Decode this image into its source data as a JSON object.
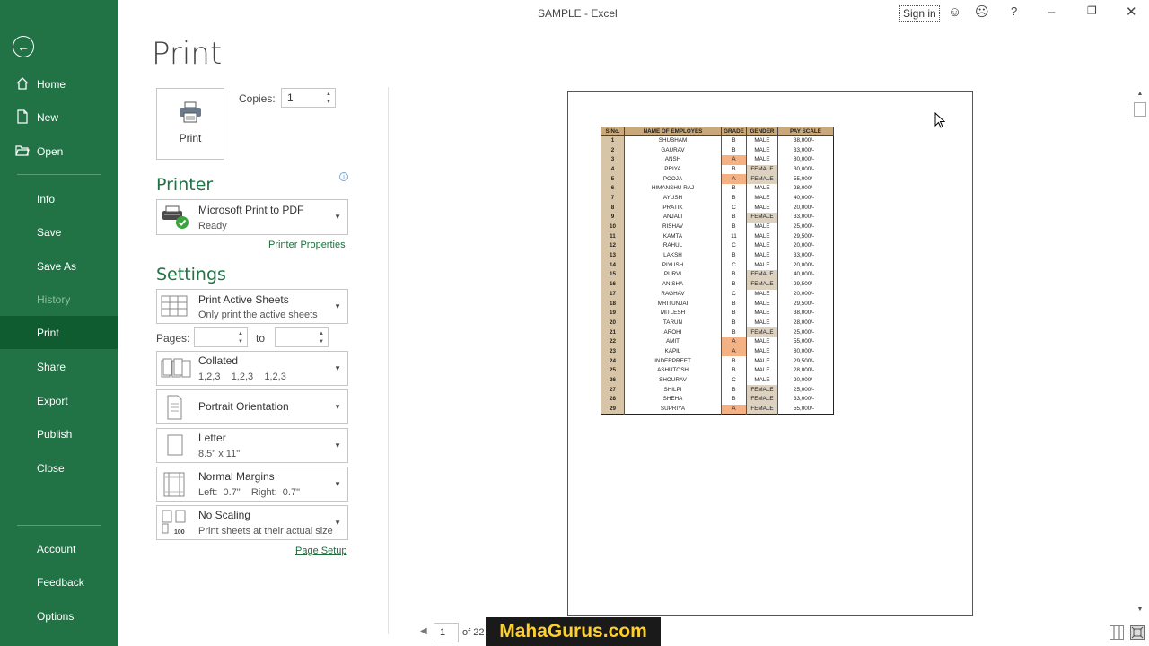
{
  "window": {
    "title": "SAMPLE  -  Excel",
    "sign_in": "Sign in",
    "help": "?",
    "smile_icon": "smile-icon",
    "frown_icon": "frown-icon"
  },
  "sidebar": {
    "items": [
      {
        "label": "Home"
      },
      {
        "label": "New"
      },
      {
        "label": "Open"
      },
      {
        "label": "Info"
      },
      {
        "label": "Save"
      },
      {
        "label": "Save As"
      },
      {
        "label": "History"
      },
      {
        "label": "Print"
      },
      {
        "label": "Share"
      },
      {
        "label": "Export"
      },
      {
        "label": "Publish"
      },
      {
        "label": "Close"
      },
      {
        "label": "Account"
      },
      {
        "label": "Feedback"
      },
      {
        "label": "Options"
      }
    ],
    "accent": "#217346",
    "active_bg": "#0e5c2f"
  },
  "print": {
    "title": "Print",
    "button_label": "Print",
    "copies_label": "Copies:",
    "copies_value": "1"
  },
  "printer": {
    "heading": "Printer",
    "name": "Microsoft Print to PDF",
    "status": "Ready",
    "properties_link": "Printer Properties"
  },
  "settings": {
    "heading": "Settings",
    "sheets": {
      "title": "Print Active Sheets",
      "desc": "Only print the active sheets"
    },
    "pages_label": "Pages:",
    "to_label": "to",
    "collate": {
      "title": "Collated",
      "desc": "1,2,3    1,2,3    1,2,3"
    },
    "orientation": {
      "title": "Portrait Orientation"
    },
    "paper": {
      "title": "Letter",
      "desc": "8.5\" x 11\""
    },
    "margins": {
      "title": "Normal Margins",
      "desc": "Left:  0.7\"    Right:  0.7\""
    },
    "scaling": {
      "title": "No Scaling",
      "desc": "Print sheets at their actual size",
      "icon_text": "100"
    },
    "page_setup_link": "Page Setup"
  },
  "preview": {
    "headers": [
      "S.No.",
      "NAME OF EMPLOYES",
      "GRADE",
      "GENDER",
      "PAY SCALE"
    ],
    "rows": [
      [
        "1",
        "SHUBHAM",
        "B",
        "MALE",
        "38,000/-"
      ],
      [
        "2",
        "GAURAV",
        "B",
        "MALE",
        "33,000/-"
      ],
      [
        "3",
        "ANSH",
        "A",
        "MALE",
        "80,000/-"
      ],
      [
        "4",
        "PRIYA",
        "B",
        "FEMALE",
        "30,000/-"
      ],
      [
        "5",
        "POOJA",
        "A",
        "FEMALE",
        "55,000/-"
      ],
      [
        "6",
        "HIMANSHU RAJ",
        "B",
        "MALE",
        "28,000/-"
      ],
      [
        "7",
        "AYUSH",
        "B",
        "MALE",
        "40,000/-"
      ],
      [
        "8",
        "PRATIK",
        "C",
        "MALE",
        "20,000/-"
      ],
      [
        "9",
        "ANJALI",
        "B",
        "FEMALE",
        "33,000/-"
      ],
      [
        "10",
        "RISHAV",
        "B",
        "MALE",
        "25,000/-"
      ],
      [
        "11",
        "KAMTA",
        "11",
        "MALE",
        "29,500/-"
      ],
      [
        "12",
        "RAHUL",
        "C",
        "MALE",
        "20,000/-"
      ],
      [
        "13",
        "LAKSH",
        "B",
        "MALE",
        "33,000/-"
      ],
      [
        "14",
        "PIYUSH",
        "C",
        "MALE",
        "20,000/-"
      ],
      [
        "15",
        "PURVI",
        "B",
        "FEMALE",
        "40,000/-"
      ],
      [
        "16",
        "ANISHA",
        "B",
        "FEMALE",
        "29,500/-"
      ],
      [
        "17",
        "RAGHAV",
        "C",
        "MALE",
        "20,000/-"
      ],
      [
        "18",
        "MRITUNJAI",
        "B",
        "MALE",
        "29,500/-"
      ],
      [
        "19",
        "MITLESH",
        "B",
        "MALE",
        "38,000/-"
      ],
      [
        "20",
        "TARUN",
        "B",
        "MALE",
        "28,000/-"
      ],
      [
        "21",
        "AROHI",
        "B",
        "FEMALE",
        "25,000/-"
      ],
      [
        "22",
        "AMIT",
        "A",
        "MALE",
        "55,000/-"
      ],
      [
        "23",
        "KAPIL",
        "A",
        "MALE",
        "80,000/-"
      ],
      [
        "24",
        "INDERPREET",
        "B",
        "MALE",
        "29,500/-"
      ],
      [
        "25",
        "ASHUTOSH",
        "B",
        "MALE",
        "28,000/-"
      ],
      [
        "26",
        "SHOURAV",
        "C",
        "MALE",
        "20,000/-"
      ],
      [
        "27",
        "SHILPI",
        "B",
        "FEMALE",
        "25,000/-"
      ],
      [
        "28",
        "SHEHA",
        "B",
        "FEMALE",
        "33,000/-"
      ],
      [
        "29",
        "SUPRIYA",
        "A",
        "FEMALE",
        "55,000/-"
      ]
    ]
  },
  "page_nav": {
    "current": "1",
    "of_text": "of 22"
  },
  "watermark": {
    "text": "MahaGurus.com",
    "color": "#ffcf2e"
  }
}
